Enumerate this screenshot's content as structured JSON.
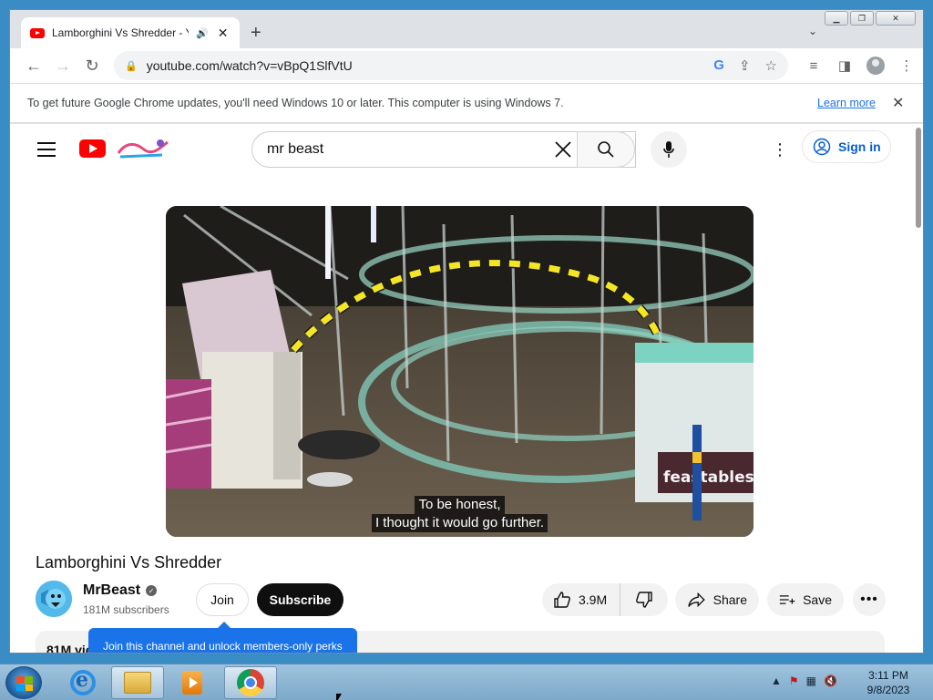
{
  "browser": {
    "tab": {
      "title": "Lamborghini Vs Shredder - Y",
      "close": "✕"
    },
    "new_tab": "+",
    "address": "youtube.com/watch?v=vBpQ1SlfVtU",
    "infobar": {
      "message": "To get future Google Chrome updates, you'll need Windows 10 or later. This computer is using Windows 7.",
      "learn_more": "Learn more",
      "close": "✕"
    }
  },
  "youtube": {
    "search": {
      "query": "mr beast"
    },
    "sign_in": "Sign in",
    "video": {
      "caption_line1": "To be honest,",
      "caption_line2": "I thought it would go further.",
      "overlay_text": "feastables."
    },
    "title": "Lamborghini Vs Shredder",
    "channel": {
      "name": "MrBeast",
      "subscribers": "181M subscribers"
    },
    "join": "Join",
    "subscribe": "Subscribe",
    "likes": "3.9M",
    "share": "Share",
    "save": "Save",
    "views": "81M vie",
    "join_tooltip": "Join this channel and unlock members-only perks"
  },
  "taskbar": {
    "time": "3:11 PM",
    "date": "9/8/2023"
  },
  "colors": {
    "youtube_red": "#ff0000",
    "link_blue": "#1a73e8",
    "sign_in_blue": "#065fd4",
    "subscribe_black": "#0f0f0f",
    "dashed_trajectory": "#f5e625"
  }
}
